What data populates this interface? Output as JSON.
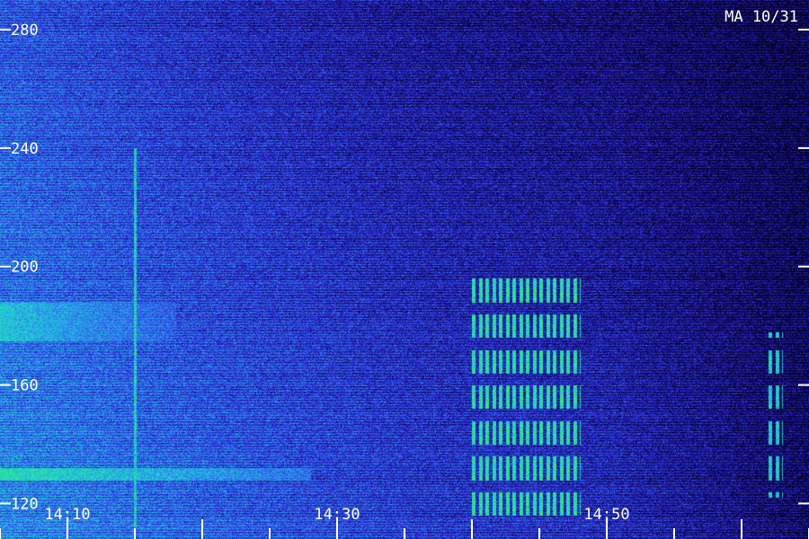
{
  "chart_data": {
    "type": "heatmap",
    "station_label": "MA 10/31",
    "y_ticks": [
      {
        "value": 280,
        "label": "280"
      },
      {
        "value": 240,
        "label": "240"
      },
      {
        "value": 200,
        "label": "200"
      },
      {
        "value": 160,
        "label": "160"
      },
      {
        "value": 120,
        "label": "120"
      }
    ],
    "y_range": [
      108,
      290
    ],
    "x_range_minutes": [
      843,
      883
    ],
    "x_ticks": [
      {
        "value": 850,
        "label": "14:10"
      },
      {
        "value": 870,
        "label": "14:30"
      },
      {
        "value": 890,
        "label": "14:50"
      }
    ],
    "x_minor_tick_step_minutes": 5,
    "x_display_range_minutes": [
      845,
      905
    ],
    "colormap": [
      "#000010",
      "#120a6e",
      "#2e2ed8",
      "#2f7cf0",
      "#1fd4d4",
      "#3cf060"
    ],
    "background_level_by_x": [
      {
        "x": 845,
        "low": 0.72,
        "high": 0.55
      },
      {
        "x": 860,
        "low": 0.6,
        "high": 0.4
      },
      {
        "x": 875,
        "low": 0.48,
        "high": 0.28
      },
      {
        "x": 890,
        "low": 0.4,
        "high": 0.2
      },
      {
        "x": 905,
        "low": 0.18,
        "high": 0.1
      }
    ],
    "features": [
      {
        "kind": "bright_band",
        "freq_range": [
          128,
          132
        ],
        "time_range": [
          845,
          868
        ],
        "level": 0.95
      },
      {
        "kind": "bright_band",
        "freq_range": [
          175,
          188
        ],
        "time_range": [
          845,
          858
        ],
        "level": 0.85
      },
      {
        "kind": "vertical_line",
        "time": 855,
        "freq_range": [
          112,
          240
        ],
        "level": 1.0
      },
      {
        "kind": "burst_cluster",
        "time_range": [
          880,
          888
        ],
        "freq_range": [
          112,
          200
        ],
        "level": 1.0
      },
      {
        "kind": "burst_cluster",
        "time_range": [
          902,
          903
        ],
        "freq_range": [
          122,
          178
        ],
        "level": 0.9
      }
    ]
  }
}
